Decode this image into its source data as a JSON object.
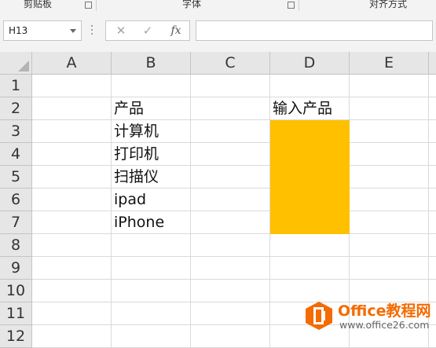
{
  "ribbon": {
    "groups": [
      "剪贴板",
      "字体",
      "对齐方式"
    ]
  },
  "formula_bar": {
    "name_box": "H13",
    "cancel_icon": "✕",
    "enter_icon": "✓",
    "fx_label": "fx",
    "formula": ""
  },
  "sheet": {
    "columns": [
      "A",
      "B",
      "C",
      "D",
      "E"
    ],
    "rows": [
      "1",
      "2",
      "3",
      "4",
      "5",
      "6",
      "7",
      "8",
      "9",
      "10",
      "11",
      "12"
    ],
    "cells": {
      "B2": "产品",
      "B3": "计算机",
      "B4": "打印机",
      "B5": "扫描仪",
      "B6": "ipad",
      "B7": "iPhone",
      "D2": "输入产品"
    },
    "highlight_range": "D3:D7",
    "highlight_color": "#ffc000"
  },
  "watermark": {
    "brand": "Office教程网",
    "url": "www.office26.com",
    "logo_color": "#f46b00"
  }
}
